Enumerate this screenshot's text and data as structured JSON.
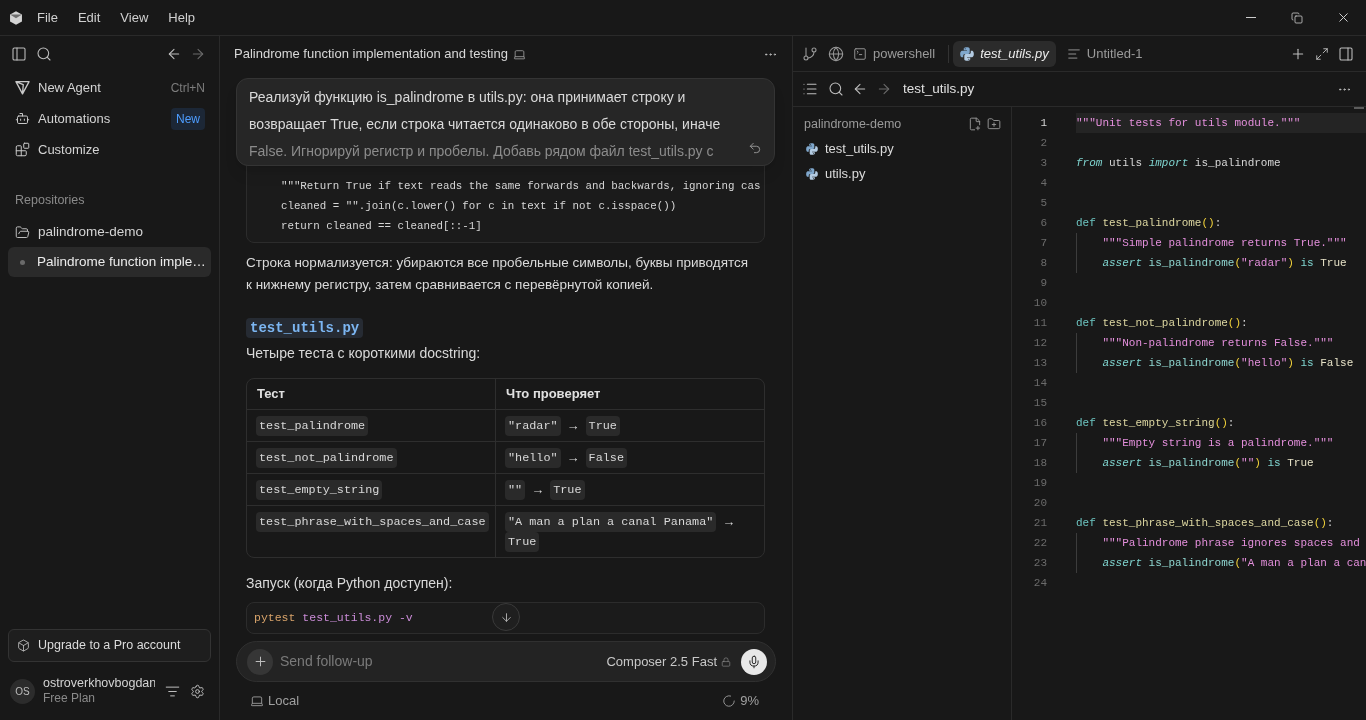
{
  "menu_bar": {
    "items": [
      "File",
      "Edit",
      "View",
      "Help"
    ]
  },
  "sidebar": {
    "nav_items": [
      {
        "label": "New Agent",
        "shortcut": "Ctrl+N"
      },
      {
        "label": "Automations",
        "badge": "New"
      },
      {
        "label": "Customize"
      }
    ],
    "section_title": "Repositories",
    "repositories": [
      {
        "name": "palindrome-demo",
        "chats": [
          {
            "title": "Palindrome function imple…",
            "selected": true
          }
        ]
      }
    ],
    "upgrade_button": "Upgrade to a Pro account",
    "user": {
      "initials": "OS",
      "name": "ostroverkhovbogdan",
      "plan": "Free Plan"
    }
  },
  "chat": {
    "title": "Palindrome function implementation and testing",
    "user_message": {
      "collapsed": true,
      "lines": [
        "Реализуй функцию is_palindrome в utils.py: она принимает строку и",
        "возвращает True, если строка читается одинаково в обе стороны, иначе",
        "False. Игнорируй регистр и пробелы. Добавь рядом файл test_utils.py с"
      ]
    },
    "code_lines": [
      "    \"\"\"Return True if text reads the same forwards and backwards, ignoring cas",
      "    cleaned = \"\".join(c.lower() for c in text if not c.isspace())",
      "    return cleaned == cleaned[::-1]"
    ],
    "explanation": "Строка нормализуется: убираются все пробельные символы, буквы приводятся к нижнему регистру, затем сравнивается с перевёрнутой копией.",
    "file_heading": "test_utils.py",
    "table_intro": "Четыре теста с короткими docstring:",
    "table": {
      "columns": [
        "Тест",
        "Что проверяет"
      ],
      "rows": [
        {
          "test": "test_palindrome",
          "result": [
            {
              "kind": "code",
              "text": "\"radar\""
            },
            {
              "kind": "arrow",
              "text": "→"
            },
            {
              "kind": "code",
              "text": "True"
            }
          ]
        },
        {
          "test": "test_not_palindrome",
          "result": [
            {
              "kind": "code",
              "text": "\"hello\""
            },
            {
              "kind": "arrow",
              "text": "→"
            },
            {
              "kind": "code",
              "text": "False"
            }
          ]
        },
        {
          "test": "test_empty_string",
          "result": [
            {
              "kind": "code",
              "text": "\"\""
            },
            {
              "kind": "arrow",
              "text": "→"
            },
            {
              "kind": "code",
              "text": "True"
            }
          ]
        },
        {
          "test": "test_phrase_with_spaces_and_case",
          "result": [
            {
              "kind": "code",
              "text": "\"A man a plan a canal Panama\""
            },
            {
              "kind": "arrow",
              "text": "→"
            },
            {
              "kind": "code",
              "text": "True"
            }
          ]
        }
      ]
    },
    "run_intro": "Запуск (когда Python доступен):",
    "command": [
      {
        "kind": "program",
        "text": "pytest"
      },
      {
        "kind": "argument",
        "text": "test_utils.py"
      },
      {
        "kind": "argument",
        "text": "-v"
      }
    ],
    "composer": {
      "placeholder": "Send follow-up",
      "model": "Composer 2.5 Fast"
    },
    "status": {
      "location": "Local",
      "progress": "9%"
    }
  },
  "editor": {
    "tabs": [
      {
        "kind": "terminal",
        "label": "powershell",
        "selected": false,
        "preview": false
      },
      {
        "kind": "python",
        "label": "test_utils.py",
        "selected": true,
        "preview": true
      },
      {
        "kind": "text",
        "label": "Untitled-1",
        "selected": false,
        "preview": false
      }
    ],
    "breadcrumb": "test_utils.py",
    "explorer": {
      "root": "palindrome-demo",
      "files": [
        "test_utils.py",
        "utils.py"
      ]
    },
    "lines": [
      {
        "number": "1",
        "current": true,
        "indented": false,
        "tokens": [
          {
            "kind": "string",
            "text": "\"\"\"Unit tests for utils module.\"\"\""
          }
        ]
      },
      {
        "number": "2",
        "current": false
      },
      {
        "number": "3",
        "current": false,
        "indented": false,
        "tokens": [
          {
            "kind": "control",
            "text": "from"
          },
          {
            "kind": "plain",
            "text": " utils "
          },
          {
            "kind": "control",
            "text": "import"
          },
          {
            "kind": "plain",
            "text": " is_palindrome"
          }
        ]
      },
      {
        "number": "4",
        "current": false
      },
      {
        "number": "5",
        "current": false
      },
      {
        "number": "6",
        "current": false,
        "indented": false,
        "tokens": [
          {
            "kind": "keyword",
            "text": "def"
          },
          {
            "kind": "function",
            "text": " test_palindrome"
          },
          {
            "kind": "paren",
            "text": "()"
          },
          {
            "kind": "plain",
            "text": ":"
          }
        ]
      },
      {
        "number": "7",
        "current": false,
        "indented": true,
        "tokens": [
          {
            "kind": "string",
            "text": "\"\"\"Simple palindrome returns True.\"\"\""
          }
        ]
      },
      {
        "number": "8",
        "current": false,
        "indented": true,
        "tokens": [
          {
            "kind": "control",
            "text": "assert"
          },
          {
            "kind": "call",
            "text": " is_palindrome"
          },
          {
            "kind": "paren",
            "text": "("
          },
          {
            "kind": "string",
            "text": "\"radar\""
          },
          {
            "kind": "paren",
            "text": ")"
          },
          {
            "kind": "operator",
            "text": " is"
          },
          {
            "kind": "constant",
            "text": " True"
          }
        ]
      },
      {
        "number": "9",
        "current": false
      },
      {
        "number": "10",
        "current": false
      },
      {
        "number": "11",
        "current": false,
        "indented": false,
        "tokens": [
          {
            "kind": "keyword",
            "text": "def"
          },
          {
            "kind": "function",
            "text": " test_not_palindrome"
          },
          {
            "kind": "paren",
            "text": "()"
          },
          {
            "kind": "plain",
            "text": ":"
          }
        ]
      },
      {
        "number": "12",
        "current": false,
        "indented": true,
        "tokens": [
          {
            "kind": "string",
            "text": "\"\"\"Non-palindrome returns False.\"\"\""
          }
        ]
      },
      {
        "number": "13",
        "current": false,
        "indented": true,
        "tokens": [
          {
            "kind": "control",
            "text": "assert"
          },
          {
            "kind": "call",
            "text": " is_palindrome"
          },
          {
            "kind": "paren",
            "text": "("
          },
          {
            "kind": "string",
            "text": "\"hello\""
          },
          {
            "kind": "paren",
            "text": ")"
          },
          {
            "kind": "operator",
            "text": " is"
          },
          {
            "kind": "constant",
            "text": " False"
          }
        ]
      },
      {
        "number": "14",
        "current": false
      },
      {
        "number": "15",
        "current": false
      },
      {
        "number": "16",
        "current": false,
        "indented": false,
        "tokens": [
          {
            "kind": "keyword",
            "text": "def"
          },
          {
            "kind": "function",
            "text": " test_empty_string"
          },
          {
            "kind": "paren",
            "text": "()"
          },
          {
            "kind": "plain",
            "text": ":"
          }
        ]
      },
      {
        "number": "17",
        "current": false,
        "indented": true,
        "tokens": [
          {
            "kind": "string",
            "text": "\"\"\"Empty string is a palindrome.\"\"\""
          }
        ]
      },
      {
        "number": "18",
        "current": false,
        "indented": true,
        "tokens": [
          {
            "kind": "control",
            "text": "assert"
          },
          {
            "kind": "call",
            "text": " is_palindrome"
          },
          {
            "kind": "paren",
            "text": "("
          },
          {
            "kind": "string",
            "text": "\"\""
          },
          {
            "kind": "paren",
            "text": ")"
          },
          {
            "kind": "operator",
            "text": " is"
          },
          {
            "kind": "constant",
            "text": " True"
          }
        ]
      },
      {
        "number": "19",
        "current": false
      },
      {
        "number": "20",
        "current": false
      },
      {
        "number": "21",
        "current": false,
        "indented": false,
        "tokens": [
          {
            "kind": "keyword",
            "text": "def"
          },
          {
            "kind": "function",
            "text": " test_phrase_with_spaces_and_case"
          },
          {
            "kind": "paren",
            "text": "()"
          },
          {
            "kind": "plain",
            "text": ":"
          }
        ]
      },
      {
        "number": "22",
        "current": false,
        "indented": true,
        "tokens": [
          {
            "kind": "string",
            "text": "\"\"\"Palindrome phrase ignores spaces and"
          }
        ]
      },
      {
        "number": "23",
        "current": false,
        "indented": true,
        "tokens": [
          {
            "kind": "control",
            "text": "assert"
          },
          {
            "kind": "call",
            "text": " is_palindrome"
          },
          {
            "kind": "paren",
            "text": "("
          },
          {
            "kind": "string",
            "text": "\"A man a plan a can"
          }
        ]
      },
      {
        "number": "24",
        "current": false
      }
    ]
  }
}
